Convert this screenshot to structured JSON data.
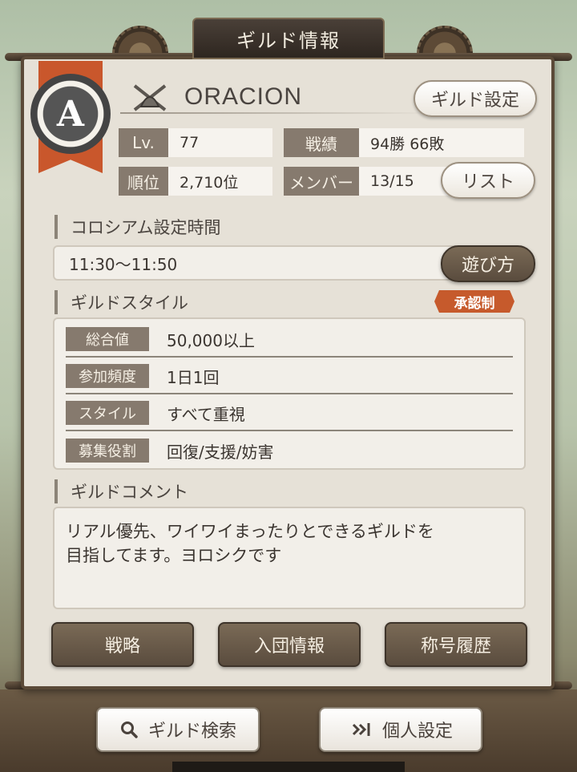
{
  "window": {
    "title": "ギルド情報"
  },
  "guild": {
    "rank_letter": "A",
    "icon": "crossed-swords-helmet-icon",
    "name": "ORACION",
    "settings_button": "ギルド設定"
  },
  "stats": {
    "level_label": "Lv.",
    "level_value": "77",
    "record_label": "戦績",
    "record_value": "94勝 66敗",
    "rank_label": "順位",
    "rank_value": "2,710位",
    "members_label": "メンバー",
    "members_value": "13/15",
    "list_button": "リスト"
  },
  "colosseum": {
    "title": "コロシアム設定時間",
    "time": "11:30〜11:50",
    "howto_button": "遊び方"
  },
  "style": {
    "title": "ギルドスタイル",
    "badge": "承認制",
    "rows": [
      {
        "label": "総合値",
        "value": "50,000以上"
      },
      {
        "label": "参加頻度",
        "value": "1日1回"
      },
      {
        "label": "スタイル",
        "value": "すべて重視"
      },
      {
        "label": "募集役割",
        "value": "回復/支援/妨害"
      }
    ]
  },
  "comment": {
    "title": "ギルドコメント",
    "lines": [
      "リアル優先、ワイワイまったりとできるギルドを",
      "目指してます。ヨロシクです"
    ]
  },
  "actions": {
    "strategy": "戦略",
    "join_info": "入団情報",
    "title_history": "称号履歴"
  },
  "footer": {
    "guild_search": "ギルド検索",
    "guild_search_icon": "search-icon",
    "personal_settings": "個人設定",
    "personal_settings_icon": "enter-arrow-icon"
  },
  "colors": {
    "accent_orange": "#c9572c",
    "label_bg": "#867a6e",
    "panel_bg": "#e6e1d7",
    "dark_button": "#6a5a48"
  }
}
